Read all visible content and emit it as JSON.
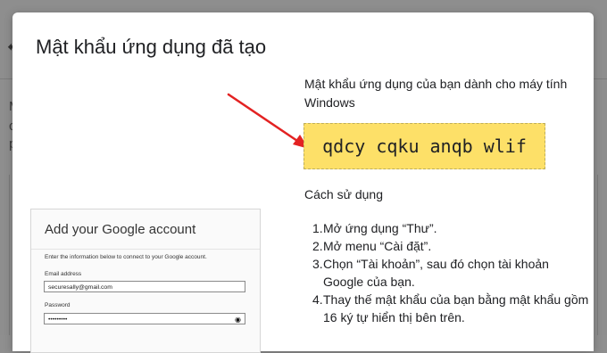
{
  "dialog": {
    "title": "Mật khẩu ứng dụng đã tạo"
  },
  "password_section": {
    "heading": "Mật khẩu ứng dụng của bạn dành cho máy tính Windows",
    "generated_password": "qdcy cqku anqb wlif",
    "box_color": "#fde068"
  },
  "usage": {
    "heading": "Cách sử dụng",
    "steps": [
      {
        "num": "1.",
        "text": "Mở ứng dụng “Thư”."
      },
      {
        "num": "2.",
        "text": "Mở menu “Cài đặt”."
      },
      {
        "num": "3.",
        "text": "Chọn “Tài khoản”, sau đó chọn tài khoản Google của bạn."
      },
      {
        "num": "4.",
        "text": "Thay thế mật khẩu của bạn bằng mật khẩu gồm 16 ký tự hiển thị bên trên."
      }
    ]
  },
  "windows_screenshot": {
    "title": "Add your Google account",
    "description": "Enter the information below to connect to your Google account.",
    "email_label": "Email address",
    "email_value": "securesally@gmail.com",
    "password_label": "Password",
    "password_value": "•••••••••",
    "eye_icon": "eye-icon"
  },
  "background": {
    "letters": [
      "M",
      "c",
      "p"
    ]
  },
  "annotation": {
    "arrow_color": "#e32222"
  }
}
